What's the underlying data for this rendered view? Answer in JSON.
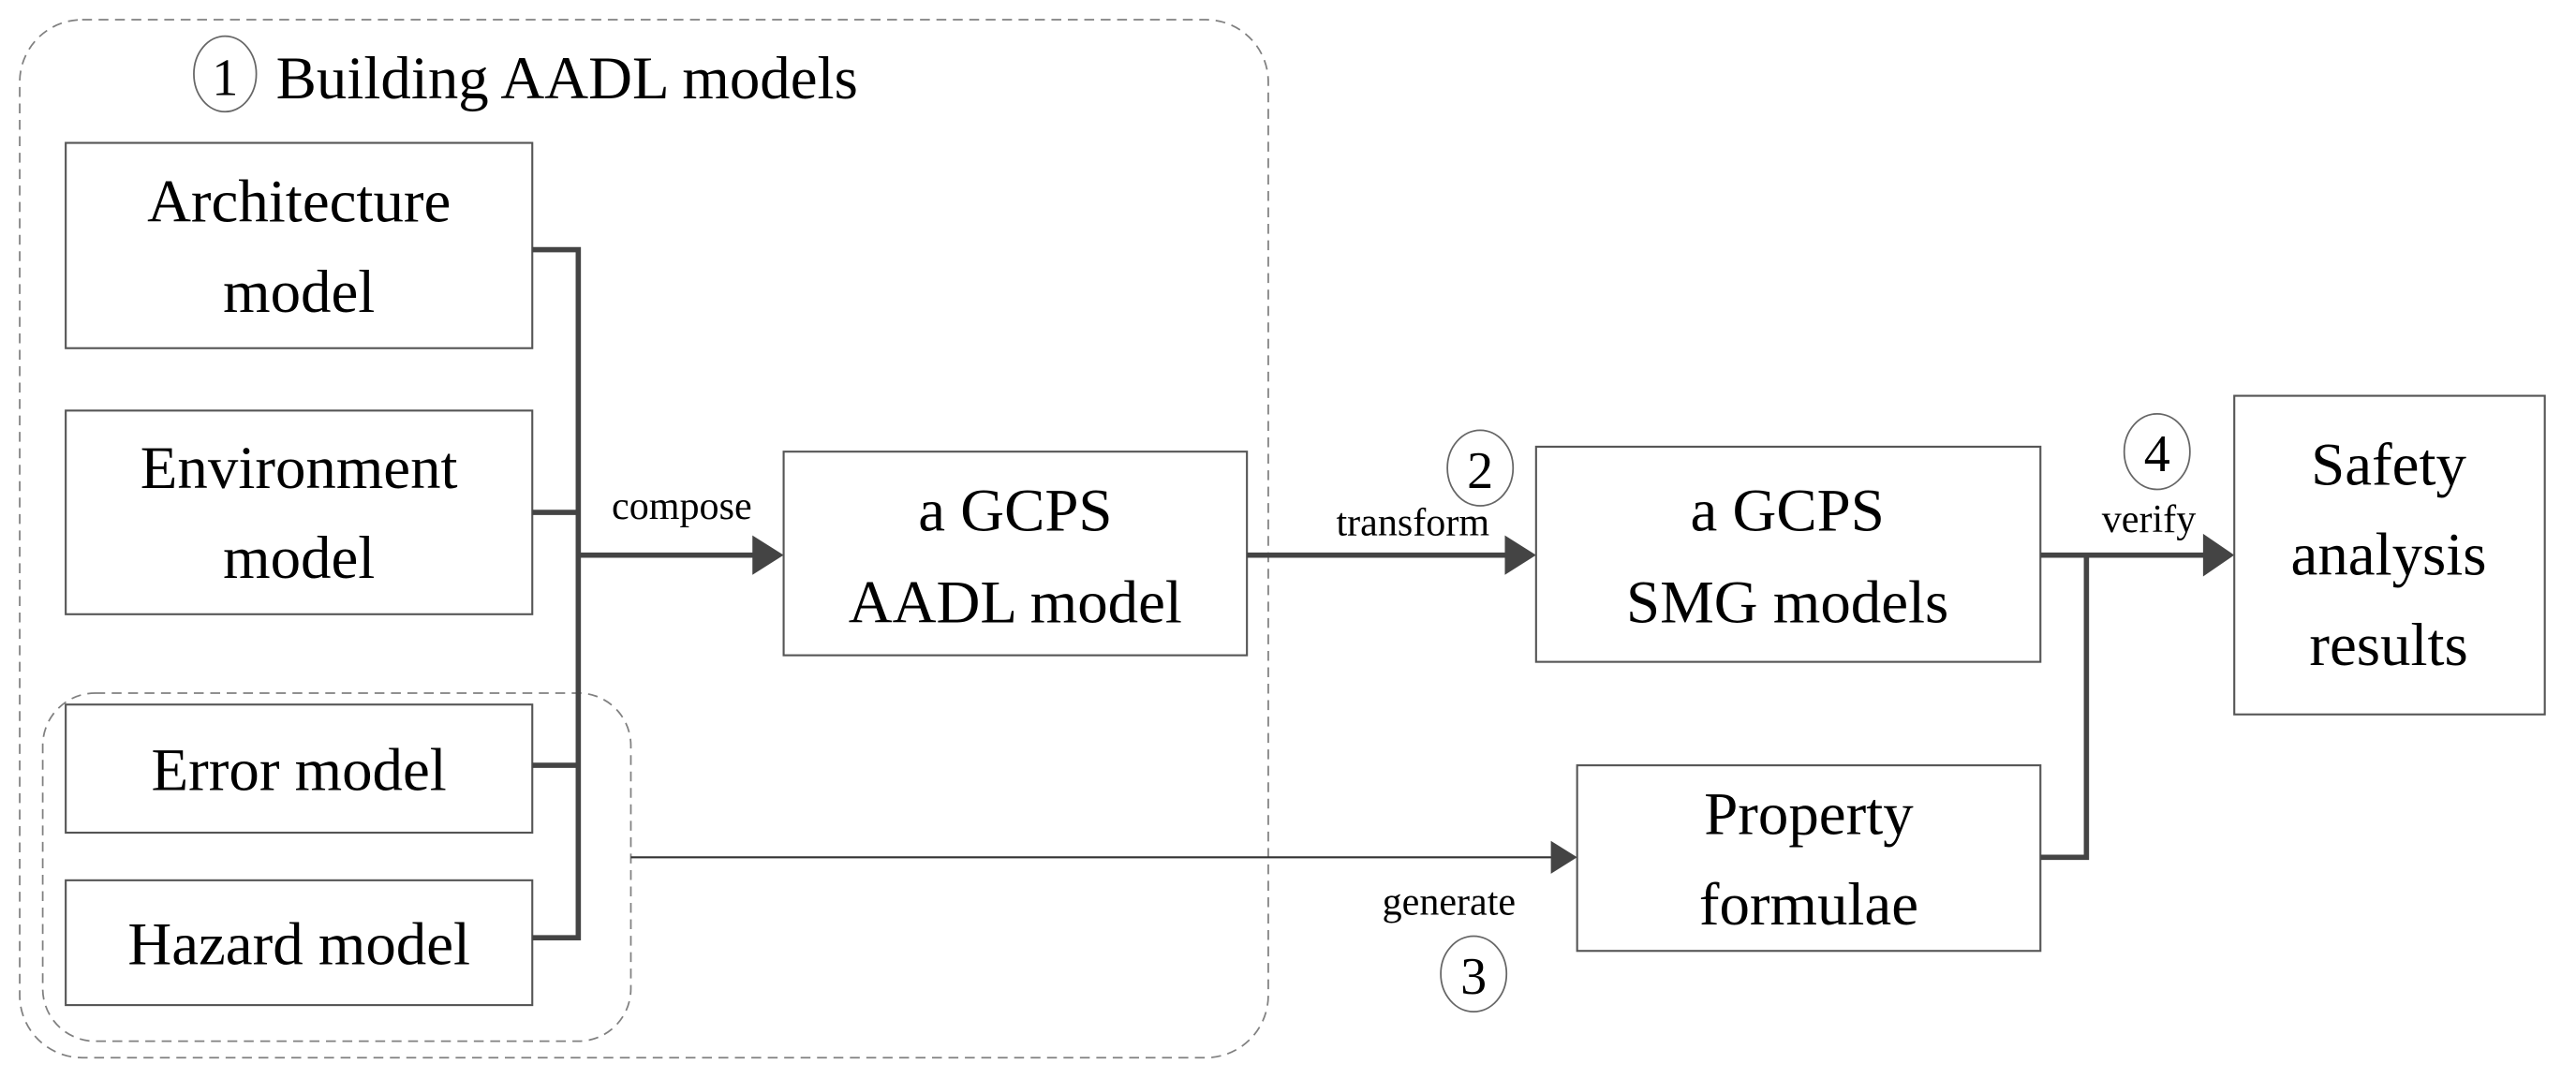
{
  "diagram": {
    "title_step_number": "1",
    "title": "Building AADL models",
    "input_models": [
      {
        "line1": "Architecture",
        "line2": "model"
      },
      {
        "line1": "Environment",
        "line2": "model"
      },
      {
        "line1": "Error model"
      },
      {
        "line1": "Hazard model"
      }
    ],
    "aadl_model": {
      "line1": "a GCPS",
      "line2": "AADL model"
    },
    "smg_models": {
      "line1": "a GCPS",
      "line2": "SMG models"
    },
    "property_formulae": {
      "line1": "Property",
      "line2": "formulae"
    },
    "results": {
      "line1": "Safety",
      "line2": "analysis",
      "line3": "results"
    },
    "edges": {
      "compose": "compose",
      "transform": "transform",
      "generate": "generate",
      "verify": "verify"
    },
    "step_numbers": {
      "transform": "2",
      "generate": "3",
      "verify": "4"
    },
    "colors": {
      "connector": "#444444",
      "box_border": "#555555",
      "dashed_group": "#808080"
    }
  }
}
